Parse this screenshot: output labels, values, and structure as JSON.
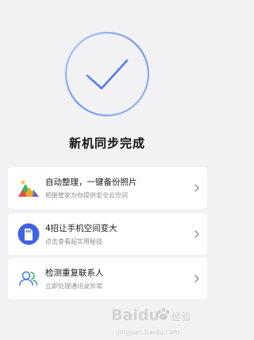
{
  "header": {
    "status_title": "新机同步完成",
    "status_icon": "check-circle-icon"
  },
  "cards": [
    {
      "title": "自动整理，一键备份照片",
      "subtitle": "相册管家为你提供安全云空间",
      "icon": "photo-landscape-icon"
    },
    {
      "title": "4招让手机空间变大",
      "subtitle": "点击查看超实用秘技",
      "icon": "storage-card-icon"
    },
    {
      "title": "检测重复联系人",
      "subtitle": "立即处理通讯录异常",
      "icon": "contacts-icon"
    }
  ],
  "watermark": {
    "brand": "Baidu",
    "sub": "jingyan.baidu.com"
  },
  "colors": {
    "accent_blue": "#4a7df0",
    "background": "#f2f2f5"
  }
}
